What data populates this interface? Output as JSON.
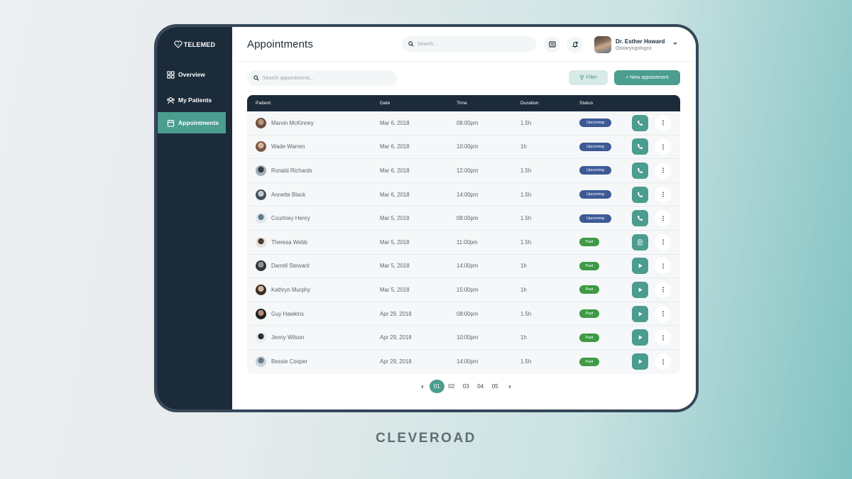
{
  "app": {
    "logo_text": "TELEMED",
    "brand_footer": "CLEVEROAD"
  },
  "sidebar": {
    "items": [
      {
        "label": "Overview",
        "icon": "grid-icon",
        "active": false
      },
      {
        "label": "My Patients",
        "icon": "patients-icon",
        "active": false
      },
      {
        "label": "Appointments",
        "icon": "calendar-icon",
        "active": true
      }
    ]
  },
  "header": {
    "title": "Appointments",
    "search_placeholder": "Search...",
    "user_name": "Dr. Esther Howard",
    "user_role": "Otolaryngologist"
  },
  "toolbar": {
    "search_placeholder": "Search appointments...",
    "filter_label": "Filter",
    "new_label": "+ New appointment"
  },
  "table": {
    "columns": [
      "Patient",
      "Date",
      "Time",
      "Duration",
      "Status"
    ],
    "rows": [
      {
        "patient": "Marvin McKinney",
        "date": "Mar 6, 2018",
        "time": "08:00pm",
        "duration": "1.5h",
        "status": "Upcoming",
        "action": "call"
      },
      {
        "patient": "Wade Warren",
        "date": "Mar 6, 2018",
        "time": "10:00pm",
        "duration": "1h",
        "status": "Upcoming",
        "action": "call"
      },
      {
        "patient": "Ronald Richards",
        "date": "Mar 6, 2018",
        "time": "12:00pm",
        "duration": "1.5h",
        "status": "Upcoming",
        "action": "call"
      },
      {
        "patient": "Annette Black",
        "date": "Mar 6, 2018",
        "time": "14:00pm",
        "duration": "1.5h",
        "status": "Upcoming",
        "action": "call"
      },
      {
        "patient": "Courtney Henry",
        "date": "Mar 5, 2018",
        "time": "08:00pm",
        "duration": "1.5h",
        "status": "Upcoming",
        "action": "call"
      },
      {
        "patient": "Theresa Webb",
        "date": "Mar 5, 2018",
        "time": "11:00pm",
        "duration": "1.5h",
        "status": "Past",
        "action": "notes"
      },
      {
        "patient": "Darrell Steward",
        "date": "Mar 5, 2018",
        "time": "14:00pm",
        "duration": "1h",
        "status": "Past",
        "action": "play"
      },
      {
        "patient": "Kathryn Murphy",
        "date": "Mar 5, 2018",
        "time": "15:00pm",
        "duration": "1h",
        "status": "Past",
        "action": "play"
      },
      {
        "patient": "Guy Hawkins",
        "date": "Apr 29, 2018",
        "time": "08:00pm",
        "duration": "1.5h",
        "status": "Past",
        "action": "play"
      },
      {
        "patient": "Jenny Wilson",
        "date": "Apr 29, 2018",
        "time": "10:00pm",
        "duration": "1h",
        "status": "Past",
        "action": "play"
      },
      {
        "patient": "Bessie Cooper",
        "date": "Apr 29, 2018",
        "time": "14:00pm",
        "duration": "1.5h",
        "status": "Past",
        "action": "play"
      }
    ]
  },
  "pagination": {
    "pages": [
      "01",
      "02",
      "03",
      "04",
      "05"
    ],
    "current": "01"
  },
  "colors": {
    "accent": "#4a9d8f",
    "sidebar_bg": "#1c2b39",
    "upcoming": "#3d5a96",
    "past": "#3e9a45"
  }
}
